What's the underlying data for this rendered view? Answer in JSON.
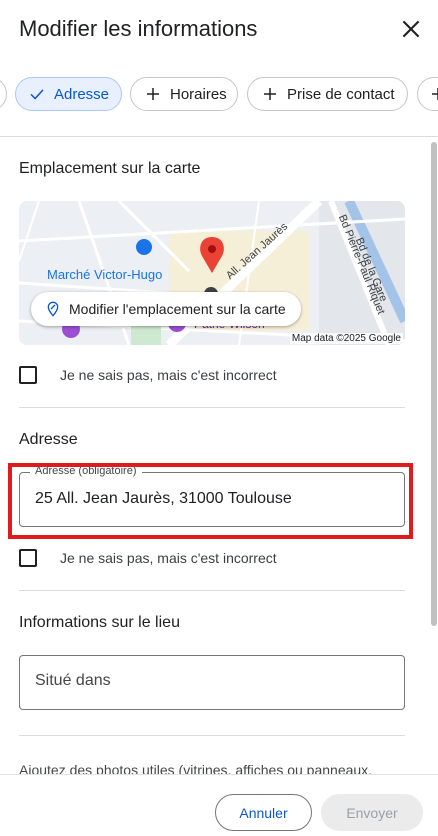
{
  "header": {
    "title": "Modifier les informations",
    "close_icon": "close-icon"
  },
  "tabs": [
    {
      "label": "Adresse",
      "selected": true,
      "icon": "check-icon"
    },
    {
      "label": "Horaires",
      "selected": false,
      "icon": "plus-icon"
    },
    {
      "label": "Prise de contact",
      "selected": false,
      "icon": "plus-icon"
    }
  ],
  "location_section": {
    "title": "Emplacement sur la carte",
    "map": {
      "edit_button_label": "Modifier l'emplacement sur la carte",
      "credit": "Map data ©2025 Google",
      "poi_label": "Marché Victor-Hugo",
      "poi_label_2": "Pathé Wilson",
      "streets": [
        "All. Jean Jaurès",
        "Bd de la Gare",
        "Bd Pierre-Paul Riquet"
      ]
    },
    "unsure_label": "Je ne sais pas, mais c'est incorrect"
  },
  "address_section": {
    "title": "Adresse",
    "field_legend": "Adresse (obligatoire)",
    "field_value": "25 All. Jean Jaurès, 31000 Toulouse",
    "unsure_label": "Je ne sais pas, mais c'est incorrect"
  },
  "place_section": {
    "title": "Informations sur le lieu",
    "situated_placeholder": "Situé dans"
  },
  "photos_hint": "Ajoutez des photos utiles (vitrines, affiches ou panneaux,",
  "footer": {
    "cancel_label": "Annuler",
    "send_label": "Envoyer"
  },
  "colors": {
    "accent": "#0b57d0",
    "selected_chip_bg": "#e8f0fe",
    "highlight": "#e01b1b"
  }
}
